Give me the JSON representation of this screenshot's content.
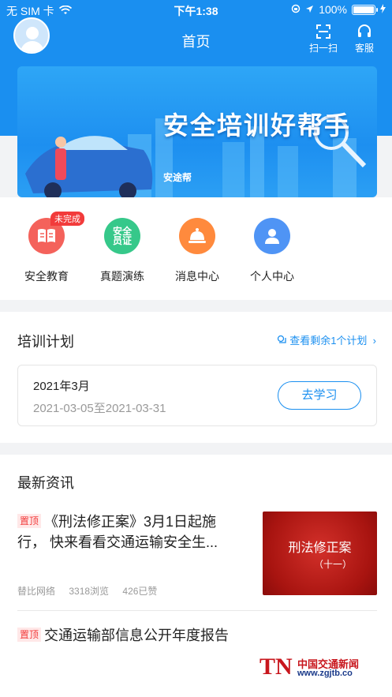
{
  "statusbar": {
    "carrier": "无 SIM 卡",
    "time": "下午1:38",
    "battery": "100%"
  },
  "navbar": {
    "title": "首页",
    "scan_label": "扫一扫",
    "service_label": "客服"
  },
  "banner": {
    "slogan": "安全培训好帮手",
    "brand": "安途帮"
  },
  "quick_menu": [
    {
      "label": "安全教育",
      "icon": "book-icon",
      "color": "#f4625b",
      "badge": "未完成"
    },
    {
      "label": "真题演练",
      "icon": "certificate-icon",
      "icon_text_1": "安全",
      "icon_text_2": "员证",
      "color": "#36c88a"
    },
    {
      "label": "消息中心",
      "icon": "bell-icon",
      "color": "#ff8a3d"
    },
    {
      "label": "个人中心",
      "icon": "person-icon",
      "color": "#4f94f5"
    }
  ],
  "plan": {
    "title": "培训计划",
    "more": "查看剩余1个计划",
    "card": {
      "month": "2021年3月",
      "range": "2021-03-05至2021-03-31",
      "button": "去学习"
    }
  },
  "news": {
    "title": "最新资讯",
    "items": [
      {
        "tag": "置顶",
        "title": "《刑法修正案》3月1日起施行， 快来看看交通运输安全生...",
        "source": "替比网络",
        "views": "3318浏览",
        "likes": "426已赞",
        "thumb_title": "刑法修正案",
        "thumb_sub": "（十一）"
      },
      {
        "tag": "置顶",
        "title": "交通运输部信息公开年度报告"
      }
    ]
  },
  "watermark": {
    "logo": "TN",
    "name": "中国交通新闻",
    "url": "www.zgjtb.co"
  },
  "colors": {
    "primary": "#1a8ff0",
    "alert": "#f23b3b"
  }
}
